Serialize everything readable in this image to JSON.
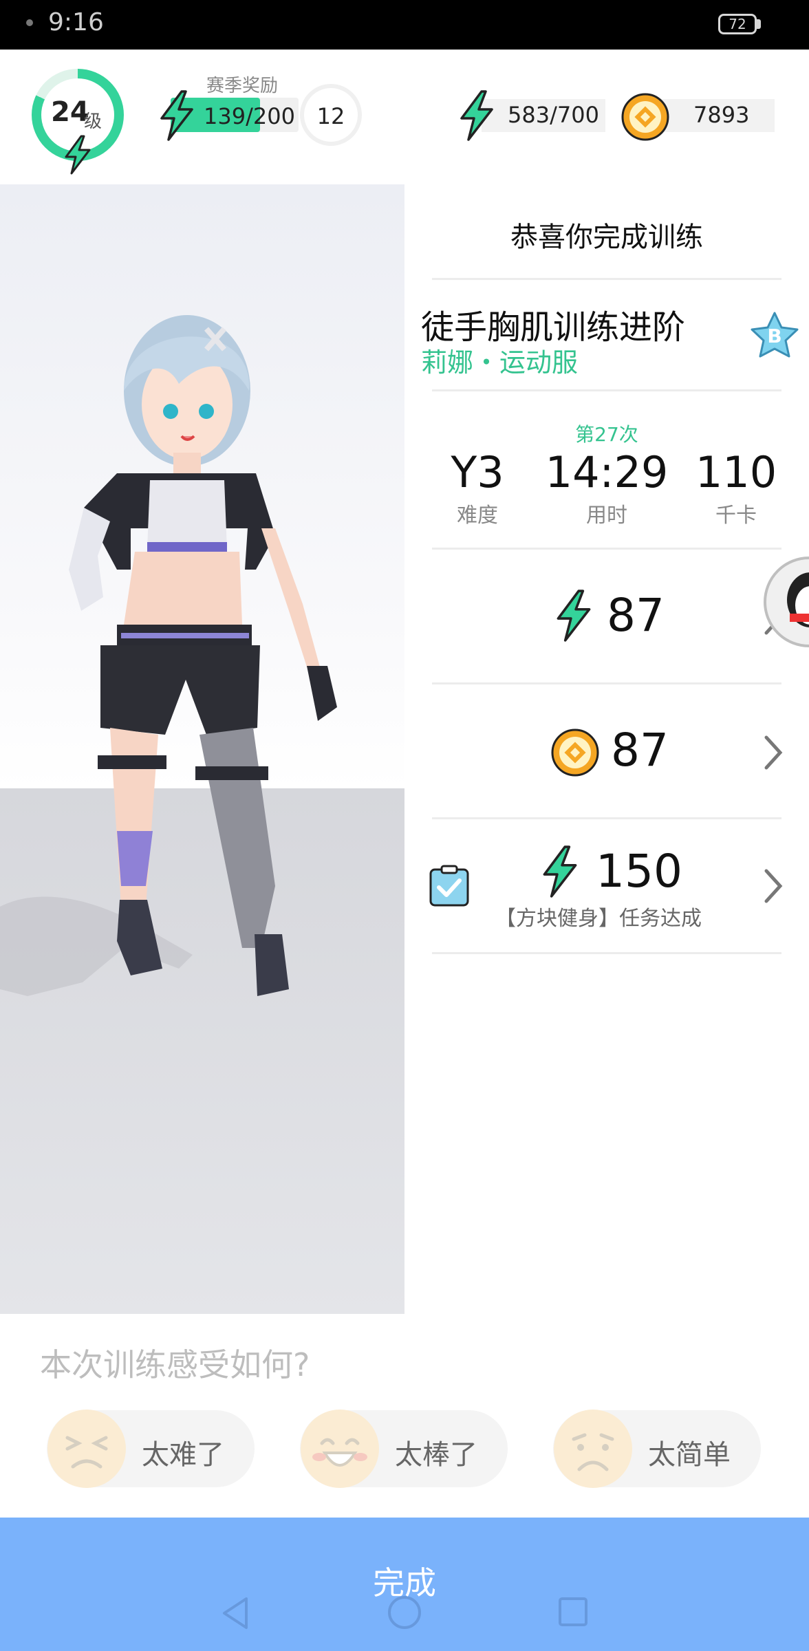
{
  "status_bar": {
    "time": "9:16",
    "battery": "72"
  },
  "header": {
    "level": {
      "number": "24",
      "unit": "级",
      "progress": 0.82
    },
    "season": {
      "label": "赛季奖励",
      "value": "139/200",
      "progress": 0.695,
      "count": "12"
    },
    "energy": {
      "value": "583/700"
    },
    "coins": {
      "value": "7893"
    }
  },
  "result": {
    "title": "恭喜你完成训练",
    "course_name": "徒手胸肌训练进阶",
    "course_sub": "莉娜・运动服",
    "grade_badge": "B",
    "session": "第27次",
    "stats": [
      {
        "value": "Y3",
        "label": "难度"
      },
      {
        "value": "14:29",
        "label": "用时"
      },
      {
        "value": "110",
        "label": "千卡"
      }
    ],
    "rewards": {
      "energy": "87",
      "coins": "87",
      "task_energy": "150",
      "task_text": "【方块健身】任务达成"
    }
  },
  "feedback": {
    "question": "本次训练感受如何?",
    "options": [
      "太难了",
      "太棒了",
      "太简单"
    ]
  },
  "done_label": "完成",
  "colors": {
    "accent_green": "#34d39a",
    "coin_orange": "#f5a623",
    "done_blue": "#7ab2fb"
  },
  "icons": [
    "lightning-icon",
    "coin-icon",
    "chevron-right-icon",
    "clipboard-check-icon",
    "star-badge-icon",
    "qq-penguin-icon",
    "back-nav-icon",
    "home-nav-icon",
    "recents-nav-icon"
  ]
}
